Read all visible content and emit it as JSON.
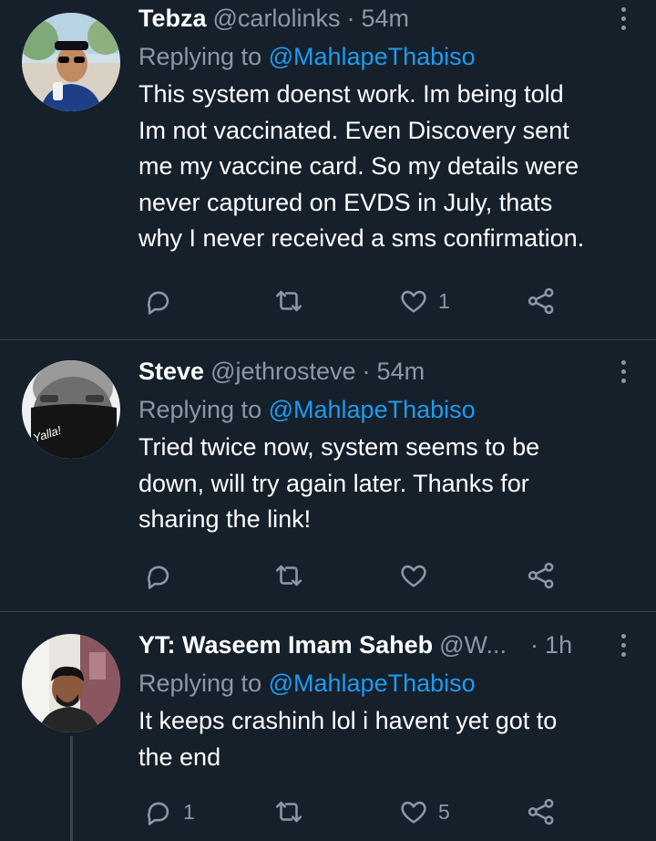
{
  "tweets": [
    {
      "name": "Tebza",
      "handle": "@carlolinks",
      "separator": "·",
      "time": "54m",
      "reply_prefix": "Replying to",
      "reply_to": "@MahlapeThabiso",
      "lines": [
        "This system doenst work. Im being told",
        "Im not vaccinated. Even Discovery sent",
        "me my vaccine card. So my details were",
        "never captured on EVDS in July, thats",
        "why I never received a sms confirmation."
      ],
      "reply_count": "",
      "retweet_count": "",
      "like_count": "1"
    },
    {
      "name": "Steve",
      "handle": "@jethrosteve",
      "separator": "·",
      "time": "54m",
      "reply_prefix": "Replying to",
      "reply_to": "@MahlapeThabiso",
      "lines": [
        "Tried twice now, system seems to be",
        "down, will try again later. Thanks for",
        "sharing the link!"
      ],
      "reply_count": "",
      "retweet_count": "",
      "like_count": ""
    },
    {
      "name": "YT: Waseem Imam Saheb",
      "handle": "@W...",
      "separator": "·",
      "time": "1h",
      "reply_prefix": "Replying to",
      "reply_to": "@MahlapeThabiso",
      "lines": [
        "It keeps crashinh lol i havent yet got to",
        "the end"
      ],
      "reply_count": "1",
      "retweet_count": "",
      "like_count": "5"
    }
  ],
  "avatar_mask_text": "Yalla!",
  "colors": {
    "background": "#15202b",
    "text": "#ffffff",
    "secondary": "#8b98a5",
    "accent": "#1d9bf0",
    "divider": "#38444d"
  },
  "icons": [
    "reply-icon",
    "retweet-icon",
    "like-icon",
    "share-icon",
    "more-icon"
  ]
}
